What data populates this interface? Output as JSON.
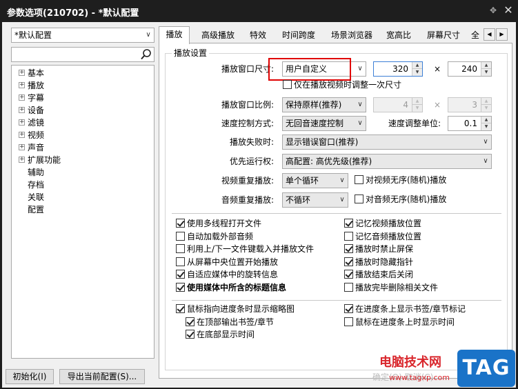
{
  "window": {
    "title": "参数选项(210702) - *默认配置",
    "pin_glyph": "✥",
    "close_glyph": "✕"
  },
  "profile": {
    "selected": "*默认配置"
  },
  "search": {
    "value": "",
    "icon": "search-icon"
  },
  "tree": {
    "items": [
      {
        "label": "基本",
        "expandable": true
      },
      {
        "label": "播放",
        "expandable": true
      },
      {
        "label": "字幕",
        "expandable": true
      },
      {
        "label": "设备",
        "expandable": true
      },
      {
        "label": "滤镜",
        "expandable": true
      },
      {
        "label": "视频",
        "expandable": true
      },
      {
        "label": "声音",
        "expandable": true
      },
      {
        "label": "扩展功能",
        "expandable": true
      },
      {
        "label": "辅助",
        "expandable": false
      },
      {
        "label": "存档",
        "expandable": false
      },
      {
        "label": "关联",
        "expandable": false
      },
      {
        "label": "配置",
        "expandable": false
      }
    ]
  },
  "tabs": [
    {
      "label": "播放",
      "active": true
    },
    {
      "label": "高级播放",
      "active": false
    },
    {
      "label": "特效",
      "active": false
    },
    {
      "label": "时间跨度",
      "active": false
    },
    {
      "label": "场景浏览器",
      "active": false
    },
    {
      "label": "宽高比",
      "active": false
    },
    {
      "label": "屏幕尺寸",
      "active": false
    },
    {
      "label": "全",
      "active": false
    }
  ],
  "tab_nav": {
    "left": "◀",
    "right": "▶"
  },
  "playback": {
    "group_title": "播放设置",
    "window_size": {
      "label": "播放窗口尺寸:",
      "selected": "用户自定义",
      "width": "320",
      "times": "×",
      "height": "240"
    },
    "adjust_once": {
      "label": "仅在播放视频时调整一次尺寸",
      "checked": false
    },
    "aspect": {
      "label": "播放窗口比例:",
      "selected": "保持原样(推荐)",
      "num": "4",
      "times": "×",
      "den": "3"
    },
    "speed_mode": {
      "label": "速度控制方式:",
      "selected": "无回音速度控制"
    },
    "speed_unit": {
      "label": "速度调整单位:",
      "value": "0.1"
    },
    "on_fail": {
      "label": "播放失败时:",
      "selected": "显示错误窗口(推荐)"
    },
    "priority": {
      "label": "优先运行权:",
      "selected": "高配置: 高优先级(推荐)"
    },
    "video_repeat": {
      "label": "视频重复播放:",
      "selected": "单个循环",
      "random_label": "对视频无序(随机)播放",
      "random_checked": false
    },
    "audio_repeat": {
      "label": "音频重复播放:",
      "selected": "不循环",
      "random_label": "对音频无序(随机)播放",
      "random_checked": false
    }
  },
  "options_left": [
    {
      "label": "使用多线程打开文件",
      "checked": true,
      "bold": false
    },
    {
      "label": "自动加载外部音频",
      "checked": false,
      "bold": false
    },
    {
      "label": "利用上/下一文件键载入并播放文件",
      "checked": false,
      "bold": false
    },
    {
      "label": "从屏幕中央位置开始播放",
      "checked": false,
      "bold": false
    },
    {
      "label": "自适应媒体中的旋转信息",
      "checked": true,
      "bold": false
    },
    {
      "label": "使用媒体中所含的标题信息",
      "checked": true,
      "bold": true
    }
  ],
  "options_right": [
    {
      "label": "记忆视频播放位置",
      "checked": true
    },
    {
      "label": "记忆音频播放位置",
      "checked": false
    },
    {
      "label": "播放时禁止屏保",
      "checked": true
    },
    {
      "label": "播放时隐藏指针",
      "checked": true
    },
    {
      "label": "播放结束后关闭",
      "checked": true
    },
    {
      "label": "播放完毕删除相关文件",
      "checked": false
    }
  ],
  "seekbar_left": [
    {
      "label": "鼠标指向进度条时显示缩略图",
      "checked": true,
      "indent": false
    },
    {
      "label": "在顶部输出书签/章节",
      "checked": true,
      "indent": true
    },
    {
      "label": "在底部显示时间",
      "checked": true,
      "indent": true
    }
  ],
  "seekbar_right": [
    {
      "label": "在进度条上显示书签/章节标记",
      "checked": true
    },
    {
      "label": "鼠标在进度条上时显示时间",
      "checked": false
    }
  ],
  "footer": {
    "reset_label": "初始化(I)",
    "export_label": "导出当前配置(S)...",
    "ok_ghost": "确定(O)   取消(C)"
  },
  "watermark": {
    "site_name": "电脑技术网",
    "site_url": "www.tagxp.com",
    "badge": "TAG",
    "badge_color": "#1a73c8",
    "text_color": "#d9262c"
  },
  "highlight_color": "#e00000"
}
